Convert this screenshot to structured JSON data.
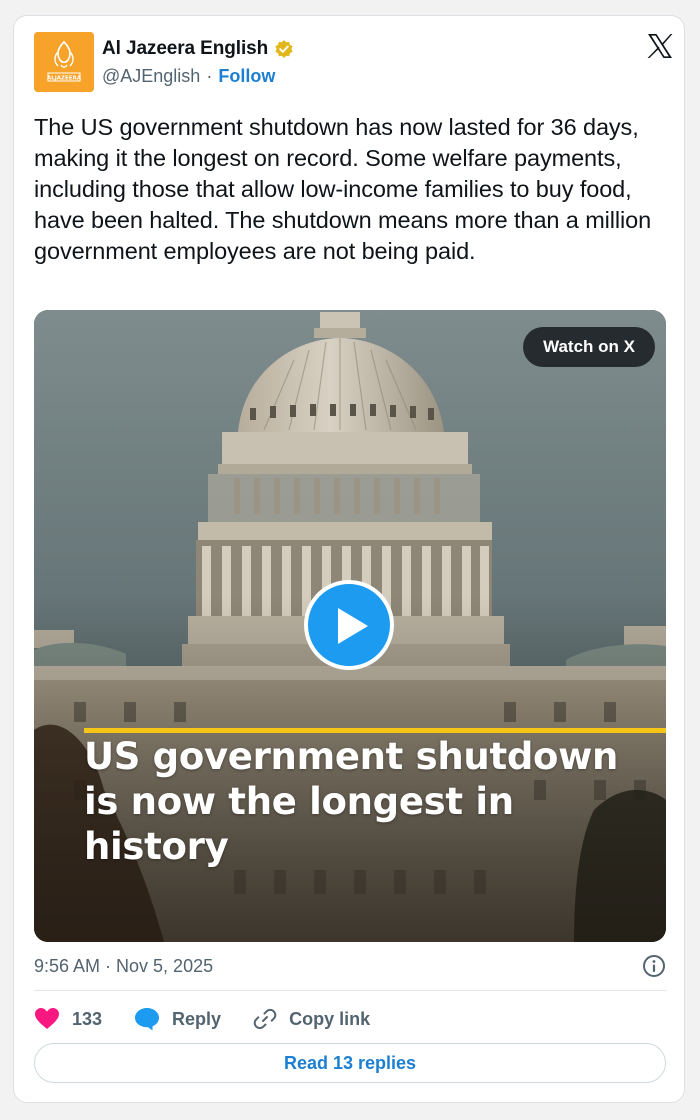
{
  "account": {
    "name": "Al Jazeera English",
    "handle": "@AJEnglish",
    "separator": "·",
    "follow_label": "Follow",
    "avatar_text": "ALJAZEERA"
  },
  "tweet": {
    "text": "The US government shutdown has now lasted for 36 days, making it the longest on record. Some welfare payments, including those that allow low-income families to buy food, have been halted. The shutdown means more than a million government employees are not being paid."
  },
  "media": {
    "watch_label": "Watch on X",
    "headline": "US government shutdown is now the longest in history"
  },
  "meta": {
    "timestamp": "9:56 AM · Nov 5, 2025"
  },
  "actions": {
    "likes_count": "133",
    "reply_label": "Reply",
    "copy_label": "Copy link"
  },
  "read_replies_label": "Read 13 replies",
  "colors": {
    "accent_blue": "#1d9bf0",
    "link_blue": "#1d7fd1",
    "like_pink": "#f91880",
    "avatar_orange": "#f7a32a",
    "verified_gold": "#e2b719",
    "headline_bar": "#f5c518"
  },
  "icons": [
    "verified-badge-icon",
    "x-logo-icon",
    "play-icon",
    "info-icon",
    "heart-icon",
    "reply-bubble-icon",
    "link-icon"
  ]
}
